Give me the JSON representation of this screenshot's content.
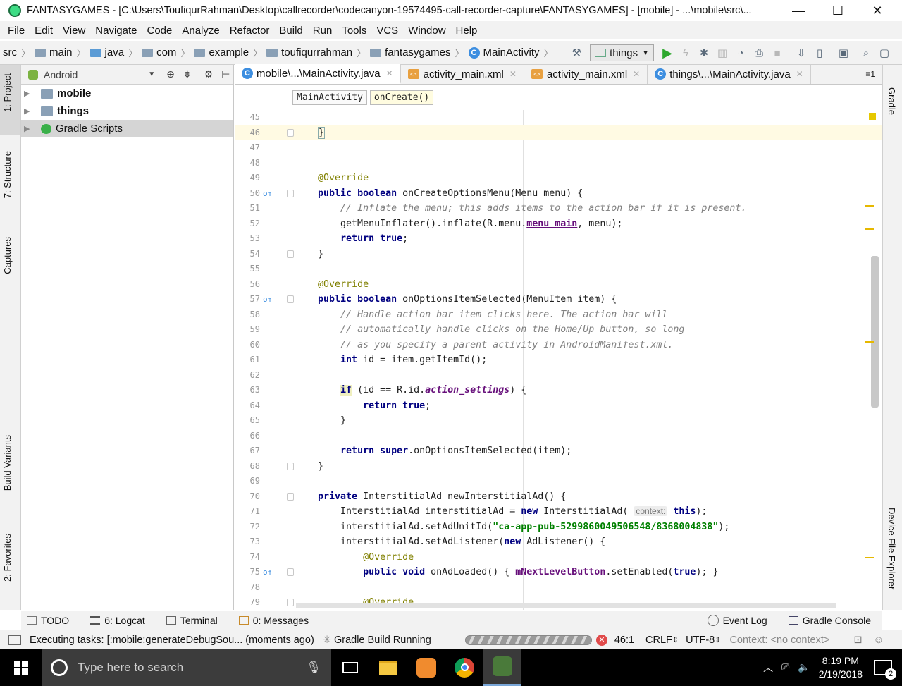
{
  "window": {
    "title": "FANTASYGAMES - [C:\\Users\\ToufiqurRahman\\Desktop\\callrecorder\\codecanyon-19574495-call-recorder-capture\\FANTASYGAMES] - [mobile] - ...\\mobile\\src\\...",
    "minimize": "—",
    "maximize": "☐",
    "close": "✕"
  },
  "menu": [
    "File",
    "Edit",
    "View",
    "Navigate",
    "Code",
    "Analyze",
    "Refactor",
    "Build",
    "Run",
    "Tools",
    "VCS",
    "Window",
    "Help"
  ],
  "navbar": {
    "crumbs": [
      "src",
      "main",
      "java",
      "com",
      "example",
      "toufiqurrahman",
      "fantasygames",
      "MainActivity"
    ],
    "run_config": "things"
  },
  "left_tabs": [
    "1: Project",
    "7: Structure",
    "Captures",
    "Build Variants",
    "2: Favorites"
  ],
  "right_tabs": [
    "Gradle",
    "Device File Explorer"
  ],
  "project": {
    "view": "Android",
    "items": [
      {
        "label": "mobile",
        "bold": true
      },
      {
        "label": "things",
        "bold": true
      },
      {
        "label": "Gradle Scripts",
        "bold": false
      }
    ]
  },
  "tabs": [
    {
      "label": "mobile\\...\\MainActivity.java",
      "active": true,
      "kind": "java"
    },
    {
      "label": "activity_main.xml",
      "active": false,
      "kind": "xml"
    },
    {
      "label": "activity_main.xml",
      "active": false,
      "kind": "xml"
    },
    {
      "label": "things\\...\\MainActivity.java",
      "active": false,
      "kind": "java"
    }
  ],
  "tabs_overflow": "≡1",
  "editor_breadcrumb": [
    "MainActivity",
    "onCreate()"
  ],
  "code_lines": [
    {
      "n": "45",
      "h": ""
    },
    {
      "n": "46",
      "h": "    <span style=\"border:1px solid #8aa;\">}</span>",
      "cur": true
    },
    {
      "n": "47",
      "h": ""
    },
    {
      "n": "48",
      "h": ""
    },
    {
      "n": "49",
      "h": "    <span class=\"ann\">@Override</span>"
    },
    {
      "n": "50",
      "h": "    <span class=\"kw\">public boolean</span> onCreateOptionsMenu(Menu menu) {",
      "g": "o↑"
    },
    {
      "n": "51",
      "h": "        <span class=\"cm\">// Inflate the menu; this adds items to the action bar if it is present.</span>"
    },
    {
      "n": "52",
      "h": "        getMenuInflater().inflate(R.menu.<span class=\"fld\" style=\"text-decoration:underline\">menu_main</span>, menu);"
    },
    {
      "n": "53",
      "h": "        <span class=\"kw\">return true</span>;"
    },
    {
      "n": "54",
      "h": "    }"
    },
    {
      "n": "55",
      "h": ""
    },
    {
      "n": "56",
      "h": "    <span class=\"ann\">@Override</span>"
    },
    {
      "n": "57",
      "h": "    <span class=\"kw\">public boolean</span> onOptionsItemSelected(MenuItem item) {",
      "g": "o↑"
    },
    {
      "n": "58",
      "h": "        <span class=\"cm\">// Handle action bar item clicks here. The action bar will</span>"
    },
    {
      "n": "59",
      "h": "        <span class=\"cm\">// automatically handle clicks on the Home/Up button, so long</span>"
    },
    {
      "n": "60",
      "h": "        <span class=\"cm\">// as you specify a parent activity in AndroidManifest.xml.</span>"
    },
    {
      "n": "61",
      "h": "        <span class=\"kw\">int</span> id = item.getItemId();"
    },
    {
      "n": "62",
      "h": ""
    },
    {
      "n": "63",
      "h": "        <span class=\"kw\" style=\"background:#f0f0c0\">if</span> (id == R.id.<span class=\"fldi\">action_settings</span>) {"
    },
    {
      "n": "64",
      "h": "            <span class=\"kw\">return true</span>;"
    },
    {
      "n": "65",
      "h": "        }"
    },
    {
      "n": "66",
      "h": ""
    },
    {
      "n": "67",
      "h": "        <span class=\"kw\">return super</span>.onOptionsItemSelected(item);"
    },
    {
      "n": "68",
      "h": "    }"
    },
    {
      "n": "69",
      "h": ""
    },
    {
      "n": "70",
      "h": "    <span class=\"kw\">private</span> InterstitialAd newInterstitialAd() {"
    },
    {
      "n": "71",
      "h": "        InterstitialAd interstitialAd = <span class=\"kw\">new</span> InterstitialAd( <span class=\"hint\">context:</span> <span class=\"kw\">this</span>);"
    },
    {
      "n": "72",
      "h": "        interstitialAd.setAdUnitId(<span class=\"str\">\"ca-app-pub-5299860049506548/8368004838\"</span>);"
    },
    {
      "n": "73",
      "h": "        interstitialAd.setAdListener(<span class=\"kw\">new</span> AdListener() {"
    },
    {
      "n": "74",
      "h": "            <span class=\"ann\">@Override</span>"
    },
    {
      "n": "75",
      "h": "            <span class=\"kw\">public void</span> onAdLoaded() { <span class=\"fld\">mNextLevelButton</span>.setEnabled(<span class=\"kw\">true</span>); }",
      "g": "o↑"
    },
    {
      "n": "78",
      "h": ""
    },
    {
      "n": "79",
      "h": "            <span class=\"ann\">@Override</span>"
    }
  ],
  "bottom_tabs": [
    {
      "icon": "todo-icon",
      "label": "TODO"
    },
    {
      "icon": "logcat-icon",
      "label": "6: Logcat"
    },
    {
      "icon": "terminal-icon",
      "label": "Terminal"
    },
    {
      "icon": "messages-icon",
      "label": "0: Messages"
    }
  ],
  "bottom_right_tabs": [
    {
      "icon": "event-log-icon",
      "label": "Event Log"
    },
    {
      "icon": "gradle-console-icon",
      "label": "Gradle Console"
    }
  ],
  "status": {
    "task": "Executing tasks: [:mobile:generateDebugSou... (moments ago)",
    "build": "Gradle Build Running",
    "position": "46:1",
    "line_sep": "CRLF",
    "encoding": "UTF-8",
    "context": "Context: <no context>"
  },
  "taskbar": {
    "search_placeholder": "Type here to search",
    "time": "8:19 PM",
    "date": "2/19/2018",
    "notifications": "2"
  },
  "colors": {
    "accent": "#3d8ee0",
    "run_green": "#2ea82e",
    "warning_marker": "#e6b800"
  }
}
